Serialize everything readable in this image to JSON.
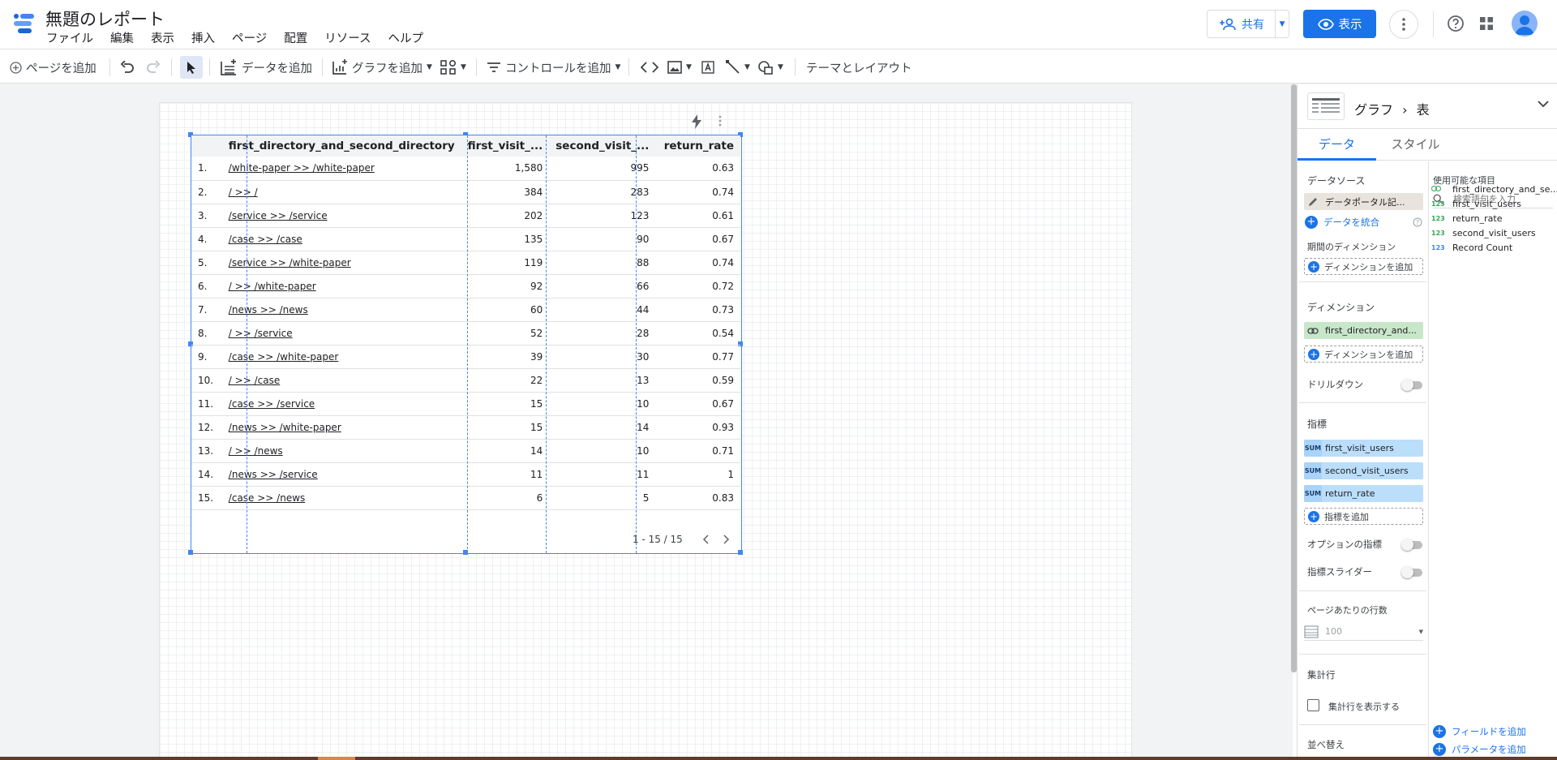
{
  "header": {
    "title": "無題のレポート",
    "menu": [
      "ファイル",
      "編集",
      "表示",
      "挿入",
      "ページ",
      "配置",
      "リソース",
      "ヘルプ"
    ],
    "share_label": "共有",
    "view_label": "表示"
  },
  "toolbar": {
    "add_page": "ページを追加",
    "add_data": "データを追加",
    "add_chart": "グラフを追加",
    "add_control": "コントロールを追加",
    "theme_layout": "テーマとレイアウト"
  },
  "table": {
    "columns": [
      "first_directory_and_second_directory",
      "first_visit_...",
      "second_visit_...",
      "return_rate"
    ],
    "rows": [
      [
        "1.",
        "/white-paper >> /white-paper",
        "1,580",
        "995",
        "0.63"
      ],
      [
        "2.",
        "/ >> /",
        "384",
        "283",
        "0.74"
      ],
      [
        "3.",
        "/service >> /service",
        "202",
        "123",
        "0.61"
      ],
      [
        "4.",
        "/case >> /case",
        "135",
        "90",
        "0.67"
      ],
      [
        "5.",
        "/service >> /white-paper",
        "119",
        "88",
        "0.74"
      ],
      [
        "6.",
        "/ >> /white-paper",
        "92",
        "66",
        "0.72"
      ],
      [
        "7.",
        "/news >> /news",
        "60",
        "44",
        "0.73"
      ],
      [
        "8.",
        "/ >> /service",
        "52",
        "28",
        "0.54"
      ],
      [
        "9.",
        "/case >> /white-paper",
        "39",
        "30",
        "0.77"
      ],
      [
        "10.",
        "/ >> /case",
        "22",
        "13",
        "0.59"
      ],
      [
        "11.",
        "/case >> /service",
        "15",
        "10",
        "0.67"
      ],
      [
        "12.",
        "/news >> /white-paper",
        "15",
        "14",
        "0.93"
      ],
      [
        "13.",
        "/ >> /news",
        "14",
        "10",
        "0.71"
      ],
      [
        "14.",
        "/news >> /service",
        "11",
        "11",
        "1"
      ],
      [
        "15.",
        "/case >> /news",
        "6",
        "5",
        "0.83"
      ]
    ],
    "pagination": "1 - 15 / 15"
  },
  "panel": {
    "breadcrumb_root": "グラフ",
    "breadcrumb_sep": "›",
    "breadcrumb_leaf": "表",
    "tab_data": "データ",
    "tab_style": "スタイル",
    "data_source_label": "データソース",
    "data_source_value": "データポータル記...",
    "blend_data": "データを統合",
    "date_dimension_label": "期間のディメンション",
    "add_dimension": "ディメンションを追加",
    "dimension_label": "ディメンション",
    "dimension_value": "first_directory_and...",
    "drilldown_label": "ドリルダウン",
    "metric_label": "指標",
    "metrics": [
      "first_visit_users",
      "second_visit_users",
      "return_rate"
    ],
    "sum_badge": "SUM",
    "add_metric": "指標を追加",
    "optional_metrics_label": "オプションの指標",
    "metric_slider_label": "指標スライダー",
    "rows_per_page_label": "ページあたりの行数",
    "rows_per_page_value": "100",
    "summary_row_label": "集計行",
    "show_summary_row": "集計行を表示する",
    "sort_label": "並べ替え",
    "available_fields_label": "使用可能な項目",
    "search_placeholder": "検索語句を入力",
    "fields": [
      {
        "type": "link",
        "name": "first_directory_and_se..."
      },
      {
        "type": "123",
        "name": "first_visit_users"
      },
      {
        "type": "123",
        "name": "return_rate"
      },
      {
        "type": "123",
        "name": "second_visit_users"
      },
      {
        "type": "123",
        "name": "Record Count"
      }
    ],
    "add_field": "フィールドを追加",
    "add_parameter": "パラメータを追加"
  },
  "colors": {
    "accent": "#1a73e8",
    "selection": "#4285f4",
    "dimension_chip": "#c8e6c9",
    "metric_chip": "#bbdefb"
  }
}
